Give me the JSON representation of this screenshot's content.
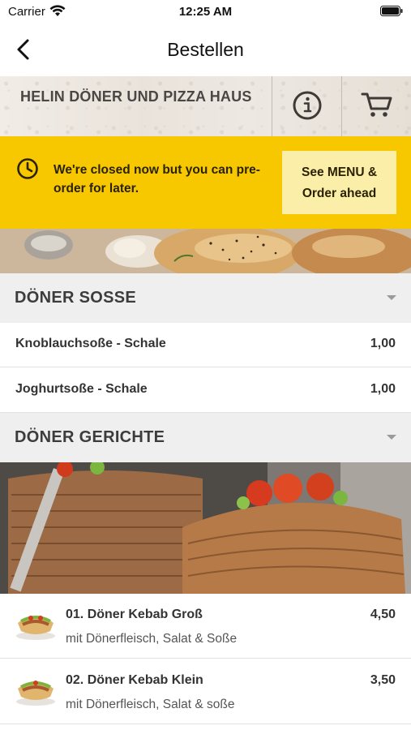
{
  "status_bar": {
    "carrier": "Carrier",
    "time": "12:25 AM"
  },
  "nav": {
    "title": "Bestellen"
  },
  "restaurant": {
    "name": "HELIN DÖNER UND PIZZA HAUS"
  },
  "banner": {
    "message": "We're closed now but you can pre-order for later.",
    "button_line1": "See MENU &",
    "button_line2": "Order ahead"
  },
  "sections": [
    {
      "title": "DÖNER SOSSE",
      "items": [
        {
          "name": "Knoblauchsoße - Schale",
          "price": "1,00"
        },
        {
          "name": "Joghurtsoße - Schale",
          "price": "1,00"
        }
      ]
    },
    {
      "title": "DÖNER GERICHTE",
      "items": [
        {
          "name": "01. Döner Kebab Groß",
          "desc": "mit Dönerfleisch, Salat & Soße",
          "price": "4,50"
        },
        {
          "name": "02. Döner Kebab Klein",
          "desc": "mit Dönerfleisch, Salat & soße",
          "price": "3,50"
        }
      ]
    }
  ],
  "icons": {
    "back": "chevron-left-icon",
    "info": "info-icon",
    "cart": "cart-icon",
    "clock": "clock-icon",
    "section_toggle": "chevron-down-icon"
  },
  "colors": {
    "banner_bg": "#f7c800",
    "banner_button_bg": "#fbeea8",
    "section_header_bg": "#efefef"
  }
}
